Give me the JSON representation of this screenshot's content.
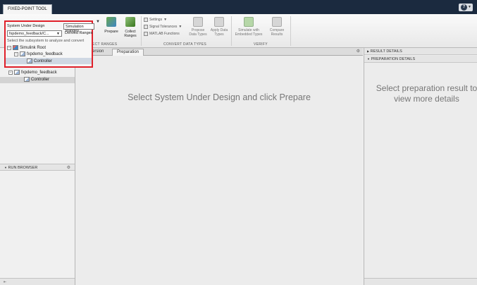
{
  "app": {
    "tab_title": "FIXED-POINT TOOL",
    "help_label": "?"
  },
  "toolstrip": {
    "sud_label": "System Under Design",
    "sud_value": "fxpdemo_feedback/C...",
    "sud_hint": "Select the subsystem to analyze and convert",
    "range_options": {
      "simulation": "Simulation Ranges",
      "derived": "Derived Ranges"
    },
    "prepare_label": "Prepare",
    "collect_ranges_label": "Collect Ranges",
    "settings_label": "Settings",
    "signal_tolerances_label": "Signal Tolerances",
    "matlab_functions_label": "MATLAB Functions",
    "propose_label": "Propose Data Types",
    "apply_label": "Apply Data Types",
    "simulate_label": "Simulate with Embedded Types",
    "compare_label": "Compare Results",
    "sections": {
      "collect": "ECT RANGES",
      "convert": "CONVERT DATA TYPES",
      "verify": "VERIFY"
    }
  },
  "left_panel": {
    "tree": [
      {
        "label": "Simulink Root",
        "expander": "−"
      },
      {
        "label": "fxpdemo_feedback",
        "expander": "−"
      },
      {
        "label": "Controller",
        "expander": ""
      }
    ],
    "main_tree": [
      {
        "label": "fxpdemo_feedback",
        "expander": "−"
      },
      {
        "label": "Controller",
        "expander": ""
      }
    ],
    "run_browser_label": "RUN BROWSER"
  },
  "center": {
    "tabs": {
      "version": "ersion",
      "preparation": "Preparation"
    },
    "message": "Select System Under Design and click Prepare"
  },
  "right_panel": {
    "result_details": "RESULT DETAILS",
    "preparation_details": "PREPARATION DETAILS",
    "message": "Select preparation result to view more details"
  },
  "colors": {
    "highlight_outline": "#e0202a",
    "title_bar": "#1b2a3f"
  }
}
